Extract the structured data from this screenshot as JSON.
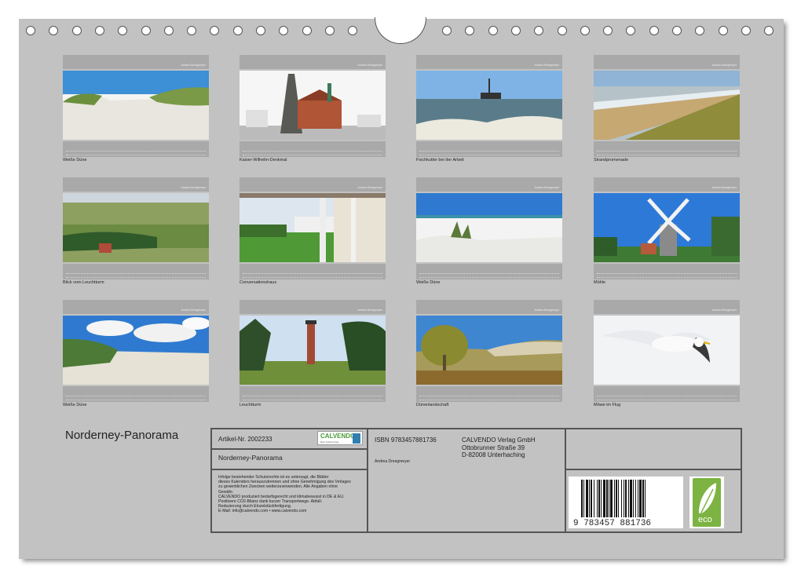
{
  "calendar": {
    "months": [
      {
        "caption": "Weiße Düne",
        "author": "Andrea Dreegmeyer",
        "scene": "dune"
      },
      {
        "caption": "Kaiser-Wilhelm-Denkmal",
        "author": "Andrea Dreegmeyer",
        "scene": "monument"
      },
      {
        "caption": "Fischkutter bei der Arbeit",
        "author": "Andrea Dreegmeyer",
        "scene": "boat"
      },
      {
        "caption": "Strandpromenade",
        "author": "Andrea Dreegmeyer",
        "scene": "promenade"
      },
      {
        "caption": "Blick vom Leuchtturm",
        "author": "Andrea Dreegmeyer",
        "scene": "landscape"
      },
      {
        "caption": "Conversationshaus",
        "author": "Andrea Dreegmeyer",
        "scene": "colonnade"
      },
      {
        "caption": "Weiße Düne",
        "author": "Andrea Dreegmeyer",
        "scene": "beachgrass"
      },
      {
        "caption": "Mühle",
        "author": "Andrea Dreegmeyer",
        "scene": "windmill"
      },
      {
        "caption": "Weiße Düne",
        "author": "Andrea Dreegmeyer",
        "scene": "clouddune"
      },
      {
        "caption": "Leuchtturm",
        "author": "Andrea Dreegmeyer",
        "scene": "lighthouse"
      },
      {
        "caption": "Dünenlandschaft",
        "author": "Andrea Dreegmeyer",
        "scene": "autumn"
      },
      {
        "caption": "Möwe im Flug",
        "author": "Andrea Dreegmeyer",
        "scene": "gull"
      }
    ]
  },
  "title": "Norderney-Panorama",
  "info": {
    "article": "Artikel-Nr. 2002233",
    "logo_text": "CALVENDO",
    "logo_sub": "Best Selbstverlag",
    "product_title": "Norderney-Panorama",
    "isbn": "ISBN 9783457881736",
    "author": "Andrea Dreegmeyer",
    "publisher": [
      "CALVENDO Verlag GmbH",
      "Ottobrunner Straße 39",
      "D-82008 Unterhaching"
    ],
    "legal": [
      "Infolge bestehender Schutzrechte ist es untersagt, die Blätter",
      "dieses Kalenders herauszutrennen und ohne Genehmigung des Verlages",
      "zu gewerblichen Zwecken weiterzuverwenden. Alle Angaben ohne",
      "Gewähr.",
      "CALVENDO produziert bedarfsgerecht und klimabewusst in DE & EU.",
      "Positivere CO2-Bilanz dank kurzer Transportwege. Abfall-",
      "Reduzierung durch Einzelstückfertigung.",
      "E-Mail: info@calvendo.com • www.calvendo.com"
    ],
    "barcode_digits": "9 783457 881736",
    "eco_label": "eco"
  },
  "colors": {
    "board": "#c2c2c2",
    "strip": "#a9a9a9",
    "border": "#555555",
    "eco": "#7cb342"
  }
}
